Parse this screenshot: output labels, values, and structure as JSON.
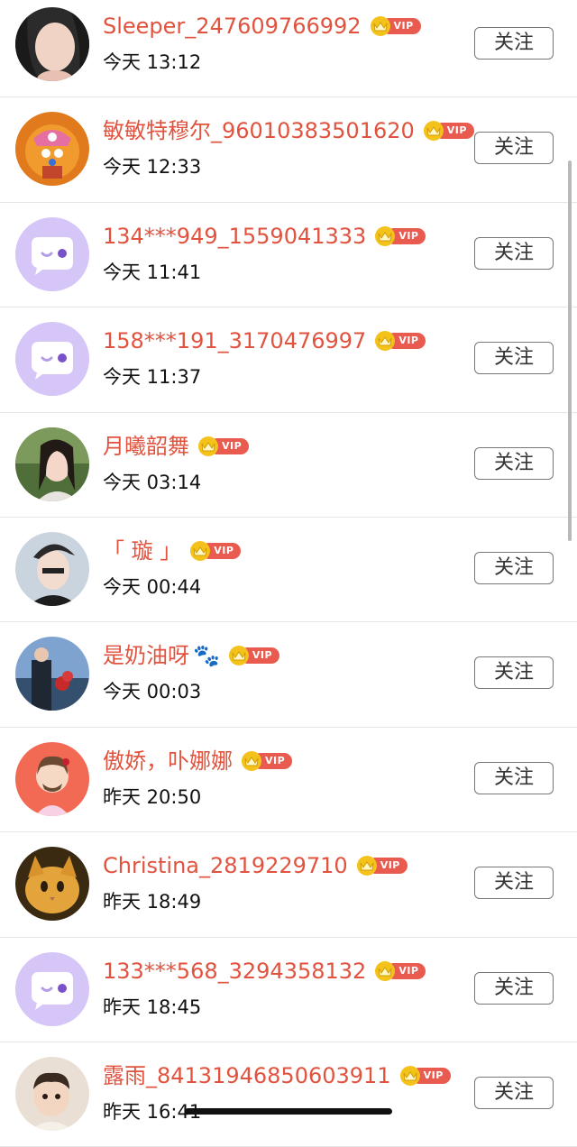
{
  "colors": {
    "name": "#e1533f",
    "vip_badge": "#e95a4f",
    "vip_crown": "#f3c21b",
    "default_avatar_bg": "#d6c5f7"
  },
  "rows": [
    {
      "name": "Sleeper_247609766992",
      "time": "今天 13:12",
      "vip": "VIP",
      "follow": "关注",
      "avatar": "photo-woman-avatar"
    },
    {
      "name": "敏敏特穆尔_96010383501620",
      "time": "今天 12:33",
      "vip": "VIP",
      "follow": "关注",
      "avatar": "chopper-avatar"
    },
    {
      "name": "134***949_1559041333",
      "time": "今天 11:41",
      "vip": "VIP",
      "follow": "关注",
      "avatar": "default-chat-avatar"
    },
    {
      "name": "158***191_3170476997",
      "time": "今天 11:37",
      "vip": "VIP",
      "follow": "关注",
      "avatar": "default-chat-avatar"
    },
    {
      "name": "月曦韶舞",
      "time": "今天 03:14",
      "vip": "VIP",
      "follow": "关注",
      "avatar": "photo-woman-avatar"
    },
    {
      "name": "「 璇 」",
      "time": "今天 00:44",
      "vip": "VIP",
      "follow": "关注",
      "avatar": "photo-man-avatar"
    },
    {
      "name": "是奶油呀",
      "time": "今天 00:03",
      "vip": "VIP",
      "follow": "关注",
      "avatar": "photo-man-flowers-avatar",
      "emoji": "🐾"
    },
    {
      "name": "傲娇，卟娜娜",
      "time": "昨天 20:50",
      "vip": "VIP",
      "follow": "关注",
      "avatar": "cartoon-avatar"
    },
    {
      "name": "Christina_2819229710",
      "time": "昨天 18:49",
      "vip": "VIP",
      "follow": "关注",
      "avatar": "cat-avatar"
    },
    {
      "name": "133***568_3294358132",
      "time": "昨天 18:45",
      "vip": "VIP",
      "follow": "关注",
      "avatar": "default-chat-avatar"
    },
    {
      "name": "露雨_84131946850603911",
      "time": "昨天 16:41",
      "vip": "VIP",
      "follow": "关注",
      "avatar": "photo-baby-avatar"
    }
  ]
}
